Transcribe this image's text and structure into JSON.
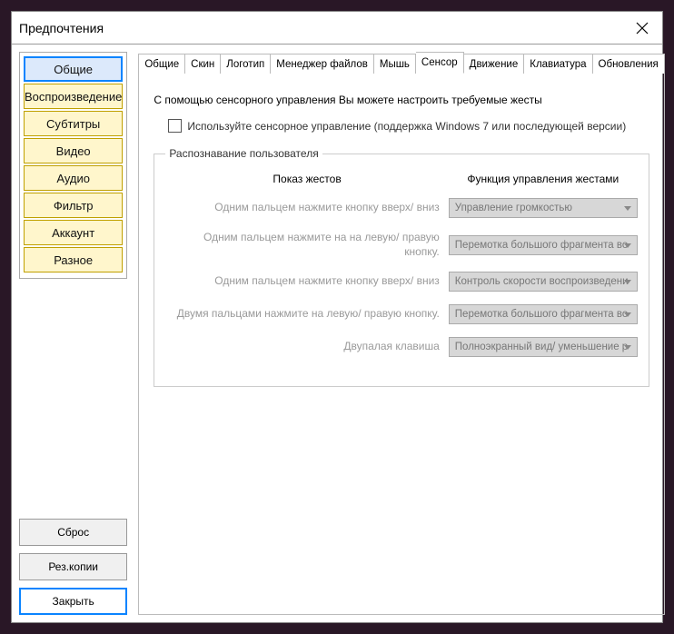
{
  "window": {
    "title": "Предпочтения"
  },
  "sidebar": {
    "items": [
      "Общие",
      "Воспроизведение",
      "Субтитры",
      "Видео",
      "Аудио",
      "Фильтр",
      "Аккаунт",
      "Разное"
    ],
    "selected_index": 0,
    "buttons": {
      "reset": "Сброс",
      "backup": "Рез.копии",
      "close": "Закрыть"
    }
  },
  "tabs": {
    "items": [
      "Общие",
      "Скин",
      "Логотип",
      "Менеджер файлов",
      "Мышь",
      "Сенсор",
      "Движение",
      "Клавиатура",
      "Обновления"
    ],
    "active_index": 5
  },
  "sensor": {
    "info": "С помощью сенсорного управления Вы можете настроить требуемые жесты",
    "checkbox_label": "Используйте сенсорное управление (поддержка Windows 7 или последующей версии)",
    "group_title": "Распознавание пользователя",
    "header_left": "Показ жестов",
    "header_right": "Функция управления жестами",
    "rows": [
      {
        "label": "Одним пальцем нажмите кнопку вверх/ вниз",
        "value": "Управление громкостью"
      },
      {
        "label": "Одним пальцем нажмите на на левую/ правую кнопку.",
        "value": "Перемотка большого фрагмента во"
      },
      {
        "label": "Одним пальцем нажмите кнопку вверх/ вниз",
        "value": "Контроль скорости воспроизведени"
      },
      {
        "label": "Двумя пальцами нажмите на левую/ правую кнопку.",
        "value": "Перемотка большого фрагмента во"
      },
      {
        "label": "Двупалая клавиша",
        "value": "Полноэкранный вид/ уменьшение р"
      }
    ]
  }
}
